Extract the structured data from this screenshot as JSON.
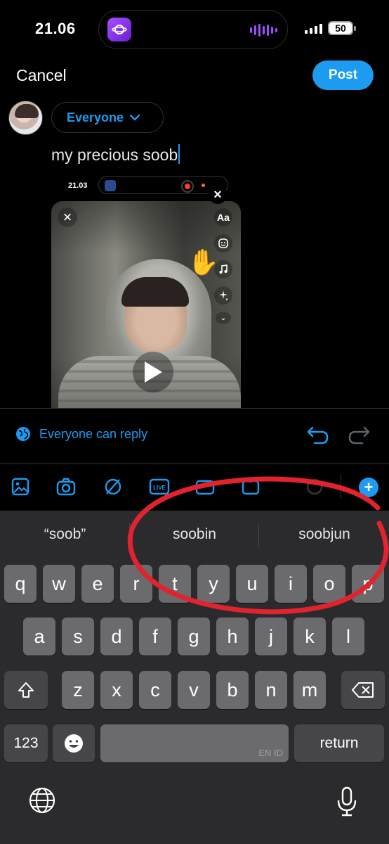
{
  "status_bar": {
    "time": "21.06",
    "battery": "50"
  },
  "header": {
    "cancel_label": "Cancel",
    "post_label": "Post"
  },
  "composer": {
    "audience_label": "Everyone",
    "text": "my precious soob"
  },
  "media": {
    "status_time": "21.03",
    "tools": {
      "text_tool": "Aa"
    }
  },
  "reply_settings": {
    "label": "Everyone can reply"
  },
  "toolbar": {
    "live_label": "LIVE"
  },
  "keyboard": {
    "suggestions": [
      "“soob”",
      "soobin",
      "soobjun"
    ],
    "row1": [
      "q",
      "w",
      "e",
      "r",
      "t",
      "y",
      "u",
      "i",
      "o",
      "p"
    ],
    "row2": [
      "a",
      "s",
      "d",
      "f",
      "g",
      "h",
      "j",
      "k",
      "l"
    ],
    "row3": [
      "z",
      "x",
      "c",
      "v",
      "b",
      "n",
      "m"
    ],
    "numbers_label": "123",
    "space_language": "EN ID",
    "return_label": "return"
  },
  "colors": {
    "accent": "#1d9bf0",
    "annotation": "#e0232e",
    "keyboard_bg": "#2b2b2d"
  }
}
